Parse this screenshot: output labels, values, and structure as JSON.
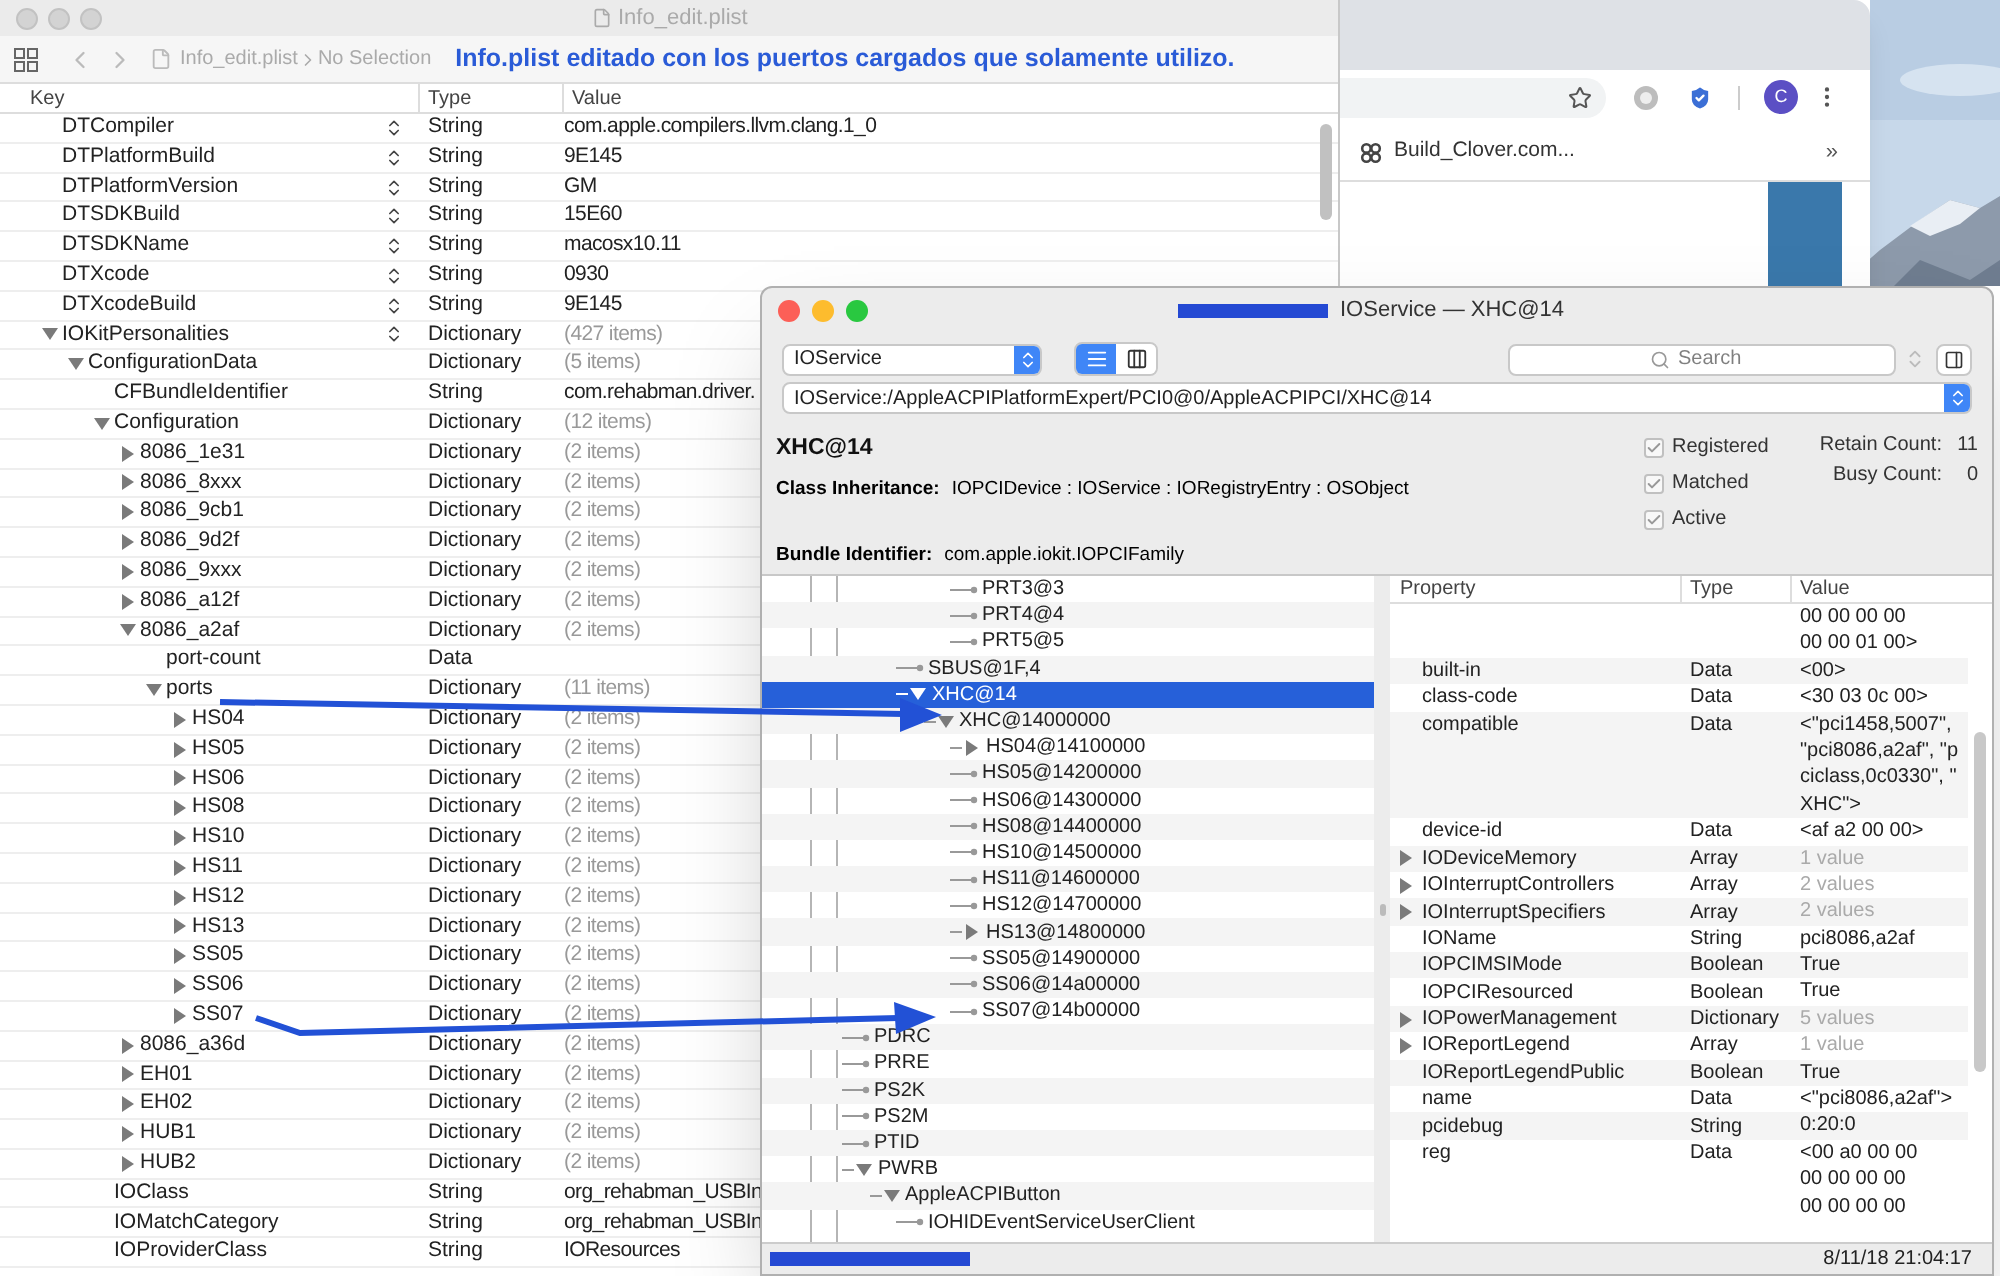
{
  "browser": {
    "bookmark": "Build_Clover.com...",
    "more": "»",
    "avatar": "C"
  },
  "plist_window": {
    "title": "Info_edit.plist",
    "breadcrumb": [
      "Info_edit.plist",
      "No Selection"
    ],
    "annotation": "Info.plist editado con los puertos cargados que solamente utilizo.",
    "columns": [
      "Key",
      "Type",
      "Value"
    ],
    "rows": [
      {
        "key": "DTCompiler",
        "type": "String",
        "value": "com.apple.compilers.llvm.clang.1_0"
      },
      {
        "key": "DTPlatformBuild",
        "type": "String",
        "value": "9E145"
      },
      {
        "key": "DTPlatformVersion",
        "type": "String",
        "value": "GM"
      },
      {
        "key": "DTSDKBuild",
        "type": "String",
        "value": "15E60"
      },
      {
        "key": "DTSDKName",
        "type": "String",
        "value": "macosx10.11"
      },
      {
        "key": "DTXcode",
        "type": "String",
        "value": "0930"
      },
      {
        "key": "DTXcodeBuild",
        "type": "String",
        "value": "9E145"
      },
      {
        "key": "IOKitPersonalities",
        "type": "Dictionary",
        "value": "(427 items)",
        "expanded": true,
        "children": [
          {
            "key": "ConfigurationData",
            "type": "Dictionary",
            "value": "(5 items)",
            "expanded": true,
            "children": [
              {
                "key": "CFBundleIdentifier",
                "type": "String",
                "value": "com.rehabman.driver."
              },
              {
                "key": "Configuration",
                "type": "Dictionary",
                "value": "(12 items)",
                "expanded": true,
                "children": [
                  {
                    "key": "8086_1e31",
                    "type": "Dictionary",
                    "value": "(2 items)",
                    "expanded": false
                  },
                  {
                    "key": "8086_8xxx",
                    "type": "Dictionary",
                    "value": "(2 items)",
                    "expanded": false
                  },
                  {
                    "key": "8086_9cb1",
                    "type": "Dictionary",
                    "value": "(2 items)",
                    "expanded": false
                  },
                  {
                    "key": "8086_9d2f",
                    "type": "Dictionary",
                    "value": "(2 items)",
                    "expanded": false
                  },
                  {
                    "key": "8086_9xxx",
                    "type": "Dictionary",
                    "value": "(2 items)",
                    "expanded": false
                  },
                  {
                    "key": "8086_a12f",
                    "type": "Dictionary",
                    "value": "(2 items)",
                    "expanded": false
                  },
                  {
                    "key": "8086_a2af",
                    "type": "Dictionary",
                    "value": "(2 items)",
                    "expanded": true,
                    "children": [
                      {
                        "key": "port-count",
                        "type": "Data"
                      },
                      {
                        "key": "ports",
                        "type": "Dictionary",
                        "value": "(11 items)",
                        "expanded": true,
                        "children": [
                          {
                            "key": "HS04",
                            "type": "Dictionary",
                            "value": "(2 items)",
                            "expanded": false
                          },
                          {
                            "key": "HS05",
                            "type": "Dictionary",
                            "value": "(2 items)",
                            "expanded": false
                          },
                          {
                            "key": "HS06",
                            "type": "Dictionary",
                            "value": "(2 items)",
                            "expanded": false
                          },
                          {
                            "key": "HS08",
                            "type": "Dictionary",
                            "value": "(2 items)",
                            "expanded": false
                          },
                          {
                            "key": "HS10",
                            "type": "Dictionary",
                            "value": "(2 items)",
                            "expanded": false
                          },
                          {
                            "key": "HS11",
                            "type": "Dictionary",
                            "value": "(2 items)",
                            "expanded": false
                          },
                          {
                            "key": "HS12",
                            "type": "Dictionary",
                            "value": "(2 items)",
                            "expanded": false
                          },
                          {
                            "key": "HS13",
                            "type": "Dictionary",
                            "value": "(2 items)",
                            "expanded": false
                          },
                          {
                            "key": "SS05",
                            "type": "Dictionary",
                            "value": "(2 items)",
                            "expanded": false
                          },
                          {
                            "key": "SS06",
                            "type": "Dictionary",
                            "value": "(2 items)",
                            "expanded": false
                          },
                          {
                            "key": "SS07",
                            "type": "Dictionary",
                            "value": "(2 items)",
                            "expanded": false
                          }
                        ]
                      }
                    ]
                  },
                  {
                    "key": "8086_a36d",
                    "type": "Dictionary",
                    "value": "(2 items)",
                    "expanded": false
                  },
                  {
                    "key": "EH01",
                    "type": "Dictionary",
                    "value": "(2 items)",
                    "expanded": false
                  },
                  {
                    "key": "EH02",
                    "type": "Dictionary",
                    "value": "(2 items)",
                    "expanded": false
                  },
                  {
                    "key": "HUB1",
                    "type": "Dictionary",
                    "value": "(2 items)",
                    "expanded": false
                  },
                  {
                    "key": "HUB2",
                    "type": "Dictionary",
                    "value": "(2 items)",
                    "expanded": false
                  }
                ]
              },
              {
                "key": "IOClass",
                "type": "String",
                "value": "org_rehabman_USBIn"
              },
              {
                "key": "IOMatchCategory",
                "type": "String",
                "value": "org_rehabman_USBIn"
              },
              {
                "key": "IOProviderClass",
                "type": "String",
                "value": "IOResources"
              }
            ]
          }
        ]
      }
    ]
  },
  "registry_window": {
    "title": "IOService — XHC@14",
    "plane": "IOService",
    "view_modes": [
      {
        "kind": "list",
        "selected": true
      },
      {
        "kind": "columns",
        "selected": false
      }
    ],
    "search_placeholder": "Search",
    "path": "IOService:/AppleACPIPlatformExpert/PCI0@0/AppleACPIPCI/XHC@14",
    "entry_name": "XHC@14",
    "class_label": "Class Inheritance:",
    "class_value": "IOPCIDevice : IOService : IORegistryEntry : OSObject",
    "bundle_label": "Bundle Identifier:",
    "bundle_value": "com.apple.iokit.IOPCIFamily",
    "flags": [
      {
        "label": "Registered",
        "checked": true
      },
      {
        "label": "Matched",
        "checked": true
      },
      {
        "label": "Active",
        "checked": true
      }
    ],
    "counts": [
      {
        "label": "Retain Count:",
        "value": "11"
      },
      {
        "label": "Busy Count:",
        "value": "0"
      }
    ],
    "tree": [
      {
        "children": [
          {
            "children": [
              {
                "children": [
                  {
                    "children": [
                      {
                        "label": "PRT3@3",
                        "selected": false
                      },
                      {
                        "label": "PRT4@4",
                        "selected": false
                      },
                      {
                        "label": "PRT5@5",
                        "selected": false
                      }
                    ]
                  }
                ]
              },
              {
                "label": "SBUS@1F,4",
                "selected": false
              },
              {
                "label": "XHC@14",
                "selected": true,
                "expanded": true,
                "children": [
                  {
                    "label": "XHC@14000000",
                    "selected": false,
                    "expanded": true,
                    "children": [
                      {
                        "label": "HS04@14100000",
                        "selected": false,
                        "expanded": false
                      },
                      {
                        "label": "HS05@14200000",
                        "selected": false
                      },
                      {
                        "label": "HS06@14300000",
                        "selected": false
                      },
                      {
                        "label": "HS08@14400000",
                        "selected": false
                      },
                      {
                        "label": "HS10@14500000",
                        "selected": false
                      },
                      {
                        "label": "HS11@14600000",
                        "selected": false
                      },
                      {
                        "label": "HS12@14700000",
                        "selected": false
                      },
                      {
                        "label": "HS13@14800000",
                        "selected": false,
                        "expanded": false
                      },
                      {
                        "label": "SS05@14900000",
                        "selected": false
                      },
                      {
                        "label": "SS06@14a00000",
                        "selected": false
                      },
                      {
                        "label": "SS07@14b00000",
                        "selected": false
                      }
                    ]
                  }
                ]
              }
            ]
          }
        ]
      },
      {
        "label": "PDRC",
        "selected": false
      },
      {
        "label": "PRRE",
        "selected": false
      },
      {
        "label": "PS2K",
        "selected": false
      },
      {
        "label": "PS2M",
        "selected": false
      },
      {
        "label": "PTID",
        "selected": false
      },
      {
        "label": "PWRB",
        "selected": false,
        "expanded": true,
        "children": [
          {
            "label": "AppleACPIButton",
            "selected": false,
            "expanded": true,
            "children": [
              {
                "label": "IOHIDEventServiceUserClient",
                "selected": false
              }
            ]
          }
        ]
      }
    ],
    "properties": {
      "columns": [
        "Property",
        "Type",
        "Value"
      ],
      "rows": [
        {
          "value_lines": [
            "00 00 00 00",
            "00 00 01 00>"
          ]
        },
        {
          "property": "built-in",
          "type": "Data",
          "value_lines": [
            "<00>"
          ]
        },
        {
          "property": "class-code",
          "type": "Data",
          "value_lines": [
            "<30 03 0c 00>"
          ]
        },
        {
          "property": "compatible",
          "type": "Data",
          "value_lines": [
            "<\"pci1458,5007\",",
            "\"pci8086,a2af\", \"p",
            "ciclass,0c0330\", \"",
            "XHC\">"
          ]
        },
        {
          "property": "device-id",
          "type": "Data",
          "value_lines": [
            "<af a2 00 00>"
          ]
        },
        {
          "property": "IODeviceMemory",
          "type": "Array",
          "value_lines": [
            "1 value"
          ],
          "expanded": false
        },
        {
          "property": "IOInterruptControllers",
          "type": "Array",
          "value_lines": [
            "2 values"
          ],
          "expanded": false
        },
        {
          "property": "IOInterruptSpecifiers",
          "type": "Array",
          "value_lines": [
            "2 values"
          ],
          "expanded": false
        },
        {
          "property": "IOName",
          "type": "String",
          "value_lines": [
            "pci8086,a2af"
          ]
        },
        {
          "property": "IOPCIMSIMode",
          "type": "Boolean",
          "value_lines": [
            "True"
          ]
        },
        {
          "property": "IOPCIResourced",
          "type": "Boolean",
          "value_lines": [
            "True"
          ]
        },
        {
          "property": "IOPowerManagement",
          "type": "Dictionary",
          "value_lines": [
            "5 values"
          ],
          "expanded": false
        },
        {
          "property": "IOReportLegend",
          "type": "Array",
          "value_lines": [
            "1 value"
          ],
          "expanded": false
        },
        {
          "property": "IOReportLegendPublic",
          "type": "Boolean",
          "value_lines": [
            "True"
          ]
        },
        {
          "property": "name",
          "type": "Data",
          "value_lines": [
            "<\"pci8086,a2af\">"
          ]
        },
        {
          "property": "pcidebug",
          "type": "String",
          "value_lines": [
            "0:20:0"
          ]
        },
        {
          "property": "reg",
          "type": "Data",
          "value_lines": [
            "<00 a0 00 00",
            "00 00 00 00",
            "00 00 00 00"
          ]
        }
      ]
    },
    "timestamp": "8/11/18 21:04:17"
  }
}
